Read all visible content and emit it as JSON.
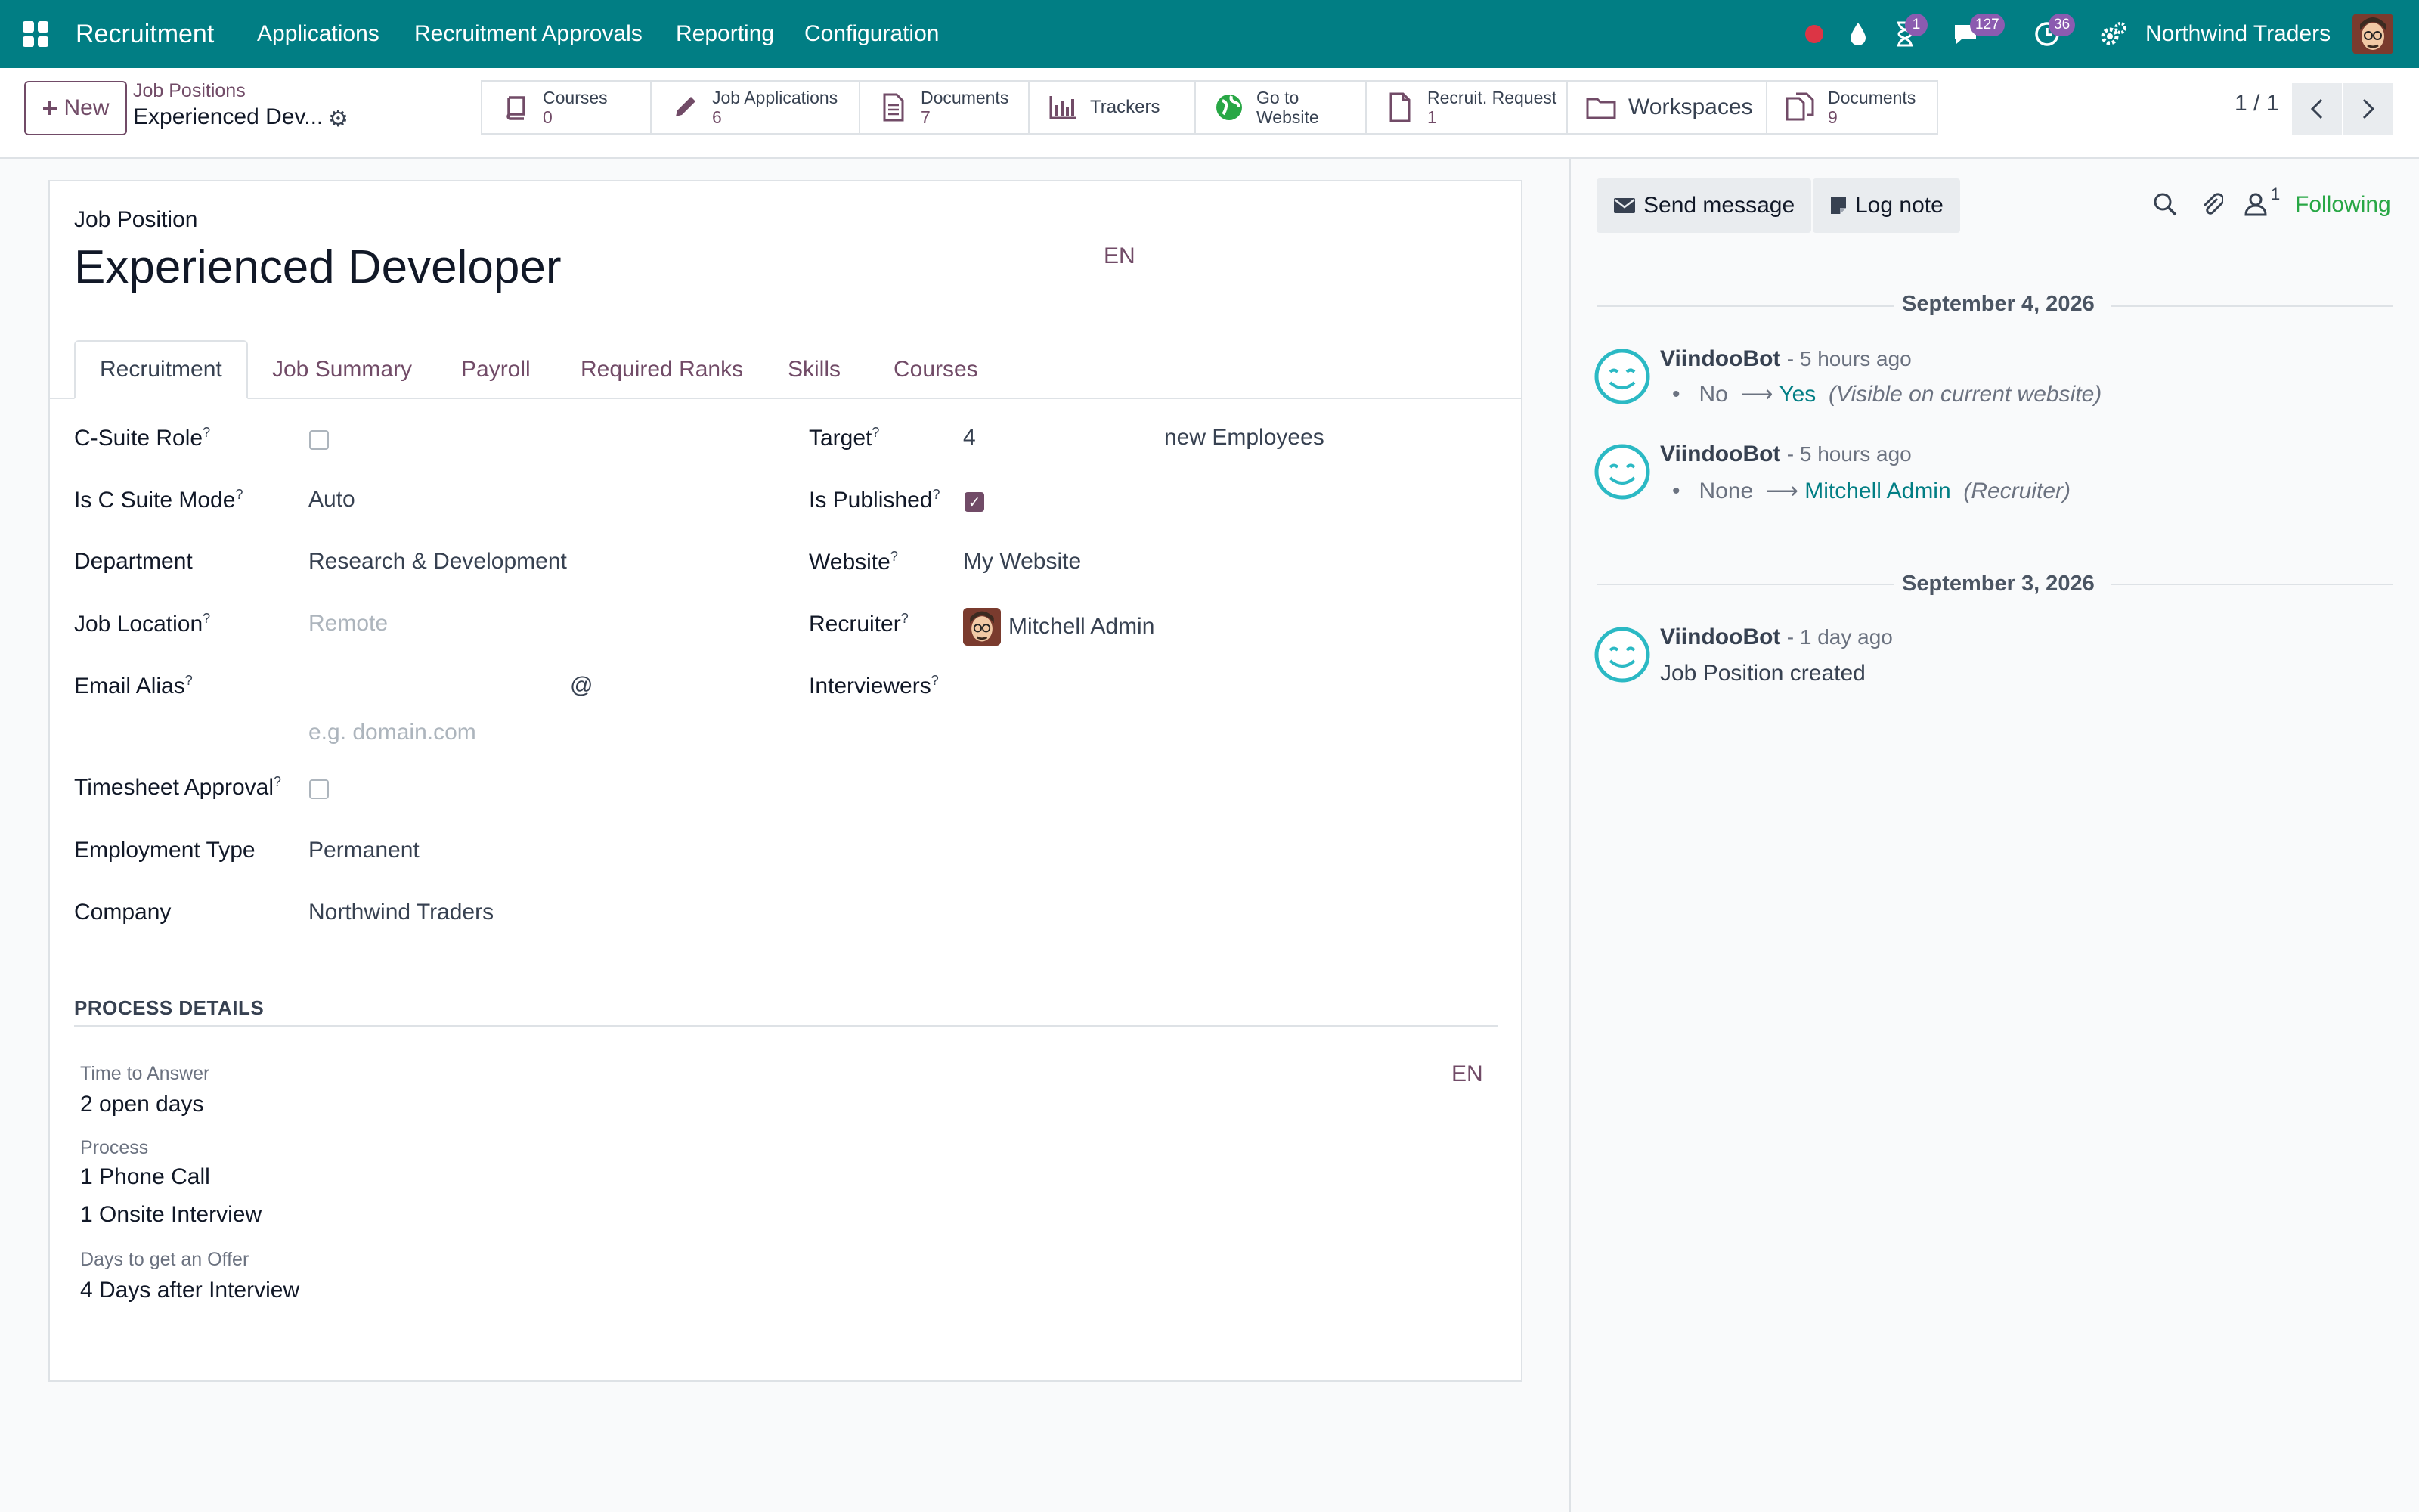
{
  "navbar": {
    "app_name": "Recruitment",
    "menu": [
      "Applications",
      "Recruitment Approvals",
      "Reporting",
      "Configuration"
    ],
    "activities_badge": "1",
    "messages_badge": "127",
    "clock_badge": "36",
    "company": "Northwind Traders",
    "accent_color": "#017e84"
  },
  "control": {
    "new_label": "New",
    "breadcrumb_parent": "Job Positions",
    "breadcrumb_current": "Experienced Dev...",
    "pager": "1 / 1",
    "smart_buttons": {
      "courses": {
        "label": "Courses",
        "count": "0"
      },
      "job_applications": {
        "label": "Job Applications",
        "count": "6"
      },
      "documents": {
        "label": "Documents",
        "count": "7"
      },
      "trackers": {
        "label": "Trackers"
      },
      "website": {
        "label_line1": "Go to",
        "label_line2": "Website"
      },
      "recruit_request": {
        "label": "Recruit. Request",
        "count": "1"
      },
      "workspaces": {
        "label": "Workspaces"
      },
      "documents2": {
        "label": "Documents",
        "count": "9"
      }
    }
  },
  "form": {
    "record_label": "Job Position",
    "title": "Experienced Developer",
    "lang": "EN",
    "tabs": [
      "Recruitment",
      "Job Summary",
      "Payroll",
      "Required Ranks",
      "Skills",
      "Courses"
    ],
    "left_fields": {
      "c_suite_role": {
        "label": "C-Suite Role",
        "checked": false
      },
      "c_suite_mode": {
        "label": "Is C Suite Mode",
        "value": "Auto"
      },
      "department": {
        "label": "Department",
        "value": "Research & Development"
      },
      "job_location": {
        "label": "Job Location",
        "placeholder": "Remote"
      },
      "email_alias": {
        "label": "Email Alias",
        "at": "@",
        "placeholder": "e.g. domain.com"
      },
      "timesheet_approval": {
        "label": "Timesheet Approval",
        "checked": false
      },
      "employment_type": {
        "label": "Employment Type",
        "value": "Permanent"
      },
      "company": {
        "label": "Company",
        "value": "Northwind Traders"
      }
    },
    "right_fields": {
      "target": {
        "label": "Target",
        "value": "4",
        "suffix": "new Employees"
      },
      "is_published": {
        "label": "Is Published",
        "checked": true
      },
      "website": {
        "label": "Website",
        "value": "My Website"
      },
      "recruiter": {
        "label": "Recruiter",
        "value": "Mitchell Admin"
      },
      "interviewers": {
        "label": "Interviewers"
      }
    },
    "tooltip_mark": "?",
    "process": {
      "heading": "PROCESS DETAILS",
      "lang": "EN",
      "time_to_answer_label": "Time to Answer",
      "time_to_answer_value": "2 open days",
      "process_label": "Process",
      "process_steps": [
        "1 Phone Call",
        "1 Onsite Interview"
      ],
      "days_offer_label": "Days to get an Offer",
      "days_offer_value": "4 Days after Interview"
    }
  },
  "chatter": {
    "send_message": "Send message",
    "log_note": "Log note",
    "followers_count": "1",
    "following": "Following",
    "groups": [
      {
        "date": "September 4, 2026",
        "messages": [
          {
            "author": "ViindooBot",
            "time": "- 5 hours ago",
            "old": "No",
            "new": "Yes",
            "note": "(Visible on current website)"
          },
          {
            "author": "ViindooBot",
            "time": "- 5 hours ago",
            "old": "None",
            "new": "Mitchell Admin",
            "note": "(Recruiter)"
          }
        ]
      },
      {
        "date": "September 3, 2026",
        "messages": [
          {
            "author": "ViindooBot",
            "time": "- 1 day ago",
            "body": "Job Position created"
          }
        ]
      }
    ]
  }
}
